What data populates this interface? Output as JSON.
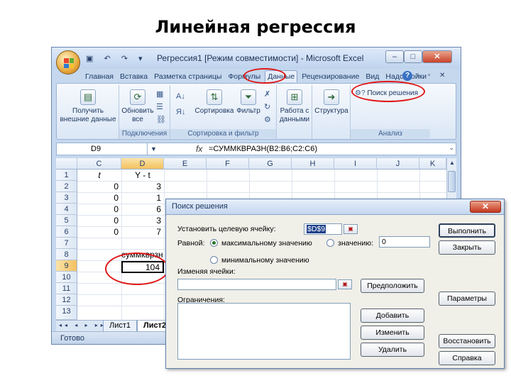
{
  "slide": {
    "title": "Линейная регрессия"
  },
  "excel": {
    "window_title": "Регрессия1 [Режим совместимости] - Microsoft Excel",
    "qat": "▣ ↶ ↷ ▾",
    "tabs": [
      "Главная",
      "Вставка",
      "Разметка страницы",
      "Формулы",
      "Данные",
      "Рецензирование",
      "Вид",
      "Надстройки"
    ],
    "active_tab": "Данные",
    "ribbon": {
      "external_data": "Получить внешние данные",
      "refresh_all": "Обновить все",
      "group_connections": "Подключения",
      "sort": "Сортировка",
      "filter": "Фильтр",
      "group_sort_filter": "Сортировка и фильтр",
      "data_tools": "Работа с данными",
      "outline": "Структура",
      "solver": "Поиск решения",
      "group_analysis": "Анализ"
    },
    "formula_bar": {
      "cell_ref": "D9",
      "fx": "fx",
      "formula": "=СУММКВРАЗН(B2:B6;C2:C6)"
    },
    "columns": [
      "C",
      "D",
      "E",
      "F",
      "G",
      "H",
      "I",
      "J",
      "K"
    ],
    "rows": [
      "1",
      "2",
      "3",
      "4",
      "5",
      "6",
      "7",
      "8",
      "9",
      "10",
      "11",
      "12",
      "13"
    ],
    "cells": {
      "c1": "t",
      "d1": "Y - t",
      "c2": "0",
      "d2": "3",
      "c3": "0",
      "d3": "1",
      "c4": "0",
      "d4": "6",
      "c5": "0",
      "d5": "3",
      "c6": "0",
      "d6": "7",
      "d8": "суммкврзн",
      "d9": "104"
    },
    "sheet_tabs": [
      "Лист1",
      "Лист2"
    ],
    "nav_arrows": "◂◂ ◂ ▸ ▸▸",
    "status": "Готово"
  },
  "solver": {
    "title": "Поиск решения",
    "target_label": "Установить целевую ячейку:",
    "target_value": "$D$9",
    "equal_label": "Равной:",
    "max_label": "максимальному значению",
    "value_label": "значению:",
    "value_input": "0",
    "min_label": "минимальному значению",
    "changing_label": "Изменяя ячейки:",
    "changing_value": "",
    "constraints_label": "Ограничения:",
    "buttons": {
      "execute": "Выполнить",
      "close": "Закрыть",
      "guess": "Предположить",
      "params": "Параметры",
      "add": "Добавить",
      "change": "Изменить",
      "delete": "Удалить",
      "restore": "Восстановить",
      "help": "Справка"
    },
    "close_glyph": "✕"
  },
  "colors": {
    "highlight_ring": "#e01515",
    "excel_blue": "#c5d8ee"
  }
}
